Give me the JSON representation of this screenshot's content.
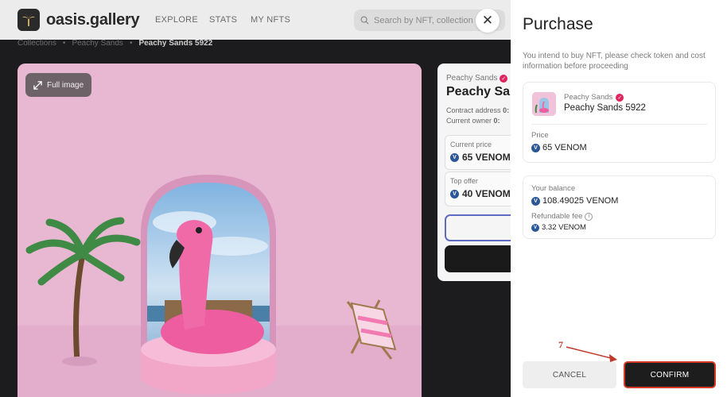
{
  "app": {
    "logo_text": "oasis.gallery",
    "nav": [
      "EXPLORE",
      "STATS",
      "MY NFTS"
    ],
    "search_placeholder": "Search by NFT, collection",
    "close_symbol": "✕"
  },
  "breadcrumb": {
    "items": [
      "Collections",
      "Peachy Sands",
      "Peachy Sands 5922"
    ],
    "separator": "•"
  },
  "image": {
    "full_image_label": "Full image"
  },
  "info_card": {
    "collection": "Peachy Sands",
    "title": "Peachy Sands 5922",
    "contract_label": "Contract address",
    "contract_value": "0:",
    "owner_label": "Current owner",
    "owner_value": "0:",
    "current_price_label": "Current price",
    "current_price_value": "65 VENOM",
    "top_offer_label": "Top offer",
    "top_offer_value": "40 VENOM"
  },
  "drawer": {
    "title": "Purchase",
    "subtitle": "You intend to buy NFT, please check token and cost information before proceeding",
    "nft_collection": "Peachy Sands",
    "nft_name": "Peachy Sands 5922",
    "price_label": "Price",
    "price_value": "65 VENOM",
    "balance_label": "Your balance",
    "balance_value": "108.49025 VENOM",
    "fee_label": "Refundable fee",
    "fee_value": "3.32 VENOM",
    "cancel_label": "CANCEL",
    "confirm_label": "CONFIRM"
  },
  "annotation": {
    "step": "7"
  },
  "colors": {
    "confirm_border": "#d63a25",
    "annotation": "#c0392b",
    "venom_badge": "#2b5797",
    "verified_badge": "#e0245e",
    "artwork_pink": "#e8b8d3"
  },
  "icons": [
    "palm-logo-icon",
    "search-icon",
    "close-icon",
    "expand-icon",
    "verified-icon",
    "venom-icon",
    "info-icon",
    "arrow-icon"
  ]
}
